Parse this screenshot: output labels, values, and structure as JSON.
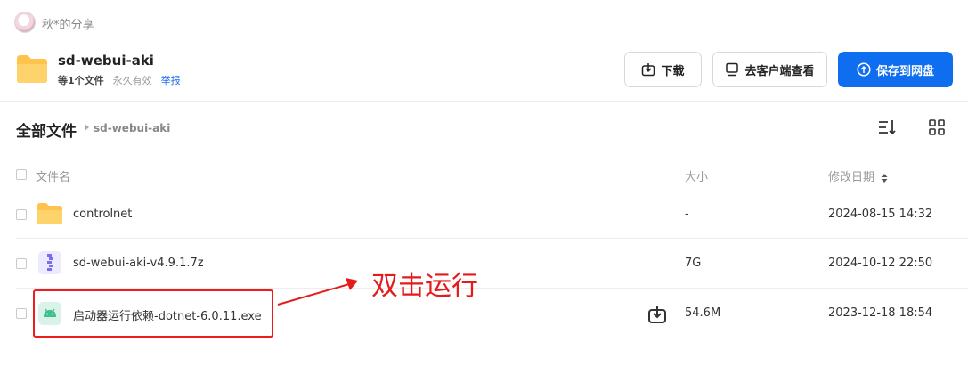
{
  "sharer": {
    "name": "秋*的分享"
  },
  "share": {
    "title": "sd-webui-aki",
    "file_count": "等1个文件",
    "validity": "永久有效",
    "report": "举报"
  },
  "actions": {
    "download": "下载",
    "open_client": "去客户端查看",
    "save_to_disk": "保存到网盘"
  },
  "breadcrumb": {
    "root": "全部文件",
    "current": "sd-webui-aki"
  },
  "table": {
    "headers": {
      "name": "文件名",
      "size": "大小",
      "modified": "修改日期"
    },
    "rows": [
      {
        "name": "controlnet",
        "size": "-",
        "modified": "2024-08-15 14:32",
        "icon": "folder-icon"
      },
      {
        "name": "sd-webui-aki-v4.9.1.7z",
        "size": "7G",
        "modified": "2024-10-12 22:50",
        "icon": "archive-icon"
      },
      {
        "name": "启动器运行依赖-dotnet-6.0.11.exe",
        "size": "54.6M",
        "modified": "2023-12-18 18:54",
        "icon": "android-icon"
      }
    ]
  },
  "annotation": {
    "text": "双击运行",
    "color": "#e51b1b"
  },
  "colors": {
    "primary": "#0f6ef0",
    "folder": "#ffc24d",
    "link": "#1e6fe8"
  }
}
